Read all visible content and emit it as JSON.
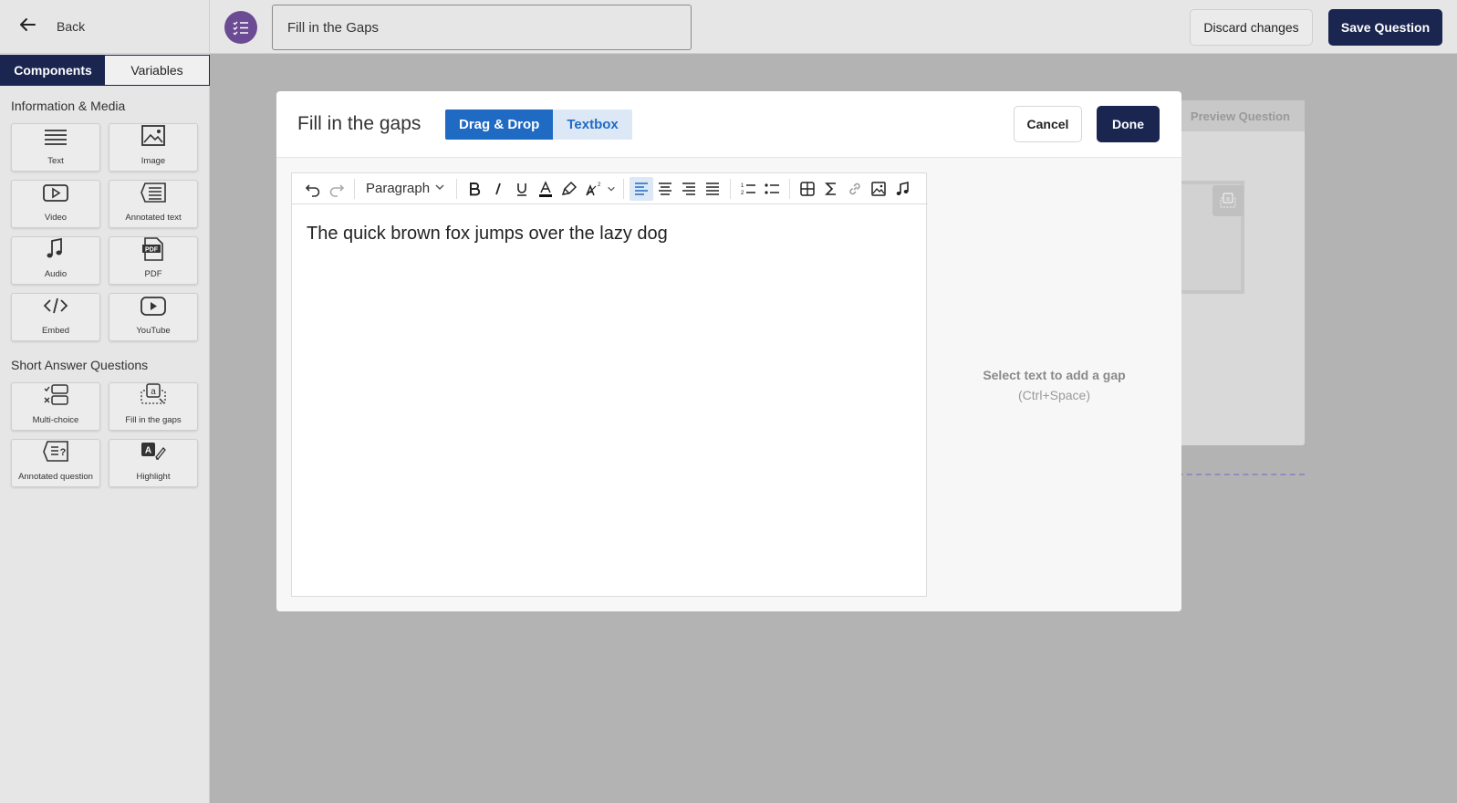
{
  "sidebar": {
    "back_label": "Back",
    "tabs": [
      {
        "label": "Components",
        "active": true
      },
      {
        "label": "Variables",
        "active": false
      }
    ],
    "sections": [
      {
        "title": "Information & Media",
        "items": [
          {
            "label": "Text",
            "icon": "text-icon"
          },
          {
            "label": "Image",
            "icon": "image-icon"
          },
          {
            "label": "Video",
            "icon": "video-icon"
          },
          {
            "label": "Annotated text",
            "icon": "annotated-text-icon"
          },
          {
            "label": "Audio",
            "icon": "audio-icon"
          },
          {
            "label": "PDF",
            "icon": "pdf-icon"
          },
          {
            "label": "Embed",
            "icon": "embed-icon"
          },
          {
            "label": "YouTube",
            "icon": "youtube-icon"
          }
        ]
      },
      {
        "title": "Short Answer Questions",
        "items": [
          {
            "label": "Multi-choice",
            "icon": "multi-choice-icon"
          },
          {
            "label": "Fill in the gaps",
            "icon": "fill-gaps-icon"
          },
          {
            "label": "Annotated question",
            "icon": "annotated-question-icon"
          },
          {
            "label": "Highlight",
            "icon": "highlight-icon"
          }
        ]
      }
    ]
  },
  "header": {
    "title_value": "Fill in the Gaps",
    "discard_label": "Discard changes",
    "save_label": "Save Question"
  },
  "background": {
    "preview_label": "Preview Question"
  },
  "modal": {
    "title": "Fill in the gaps",
    "modes": [
      {
        "label": "Drag & Drop",
        "active": true
      },
      {
        "label": "Textbox",
        "active": false
      }
    ],
    "cancel_label": "Cancel",
    "done_label": "Done",
    "toolbar": {
      "block_format": "Paragraph"
    },
    "content": "The quick brown fox jumps over the lazy dog",
    "hint": "Select text to add a gap",
    "shortcut": "(Ctrl+Space)"
  },
  "colors": {
    "navy": "#1a2550",
    "accent_blue": "#1f6bc4",
    "logo_purple": "#6b4c94"
  }
}
